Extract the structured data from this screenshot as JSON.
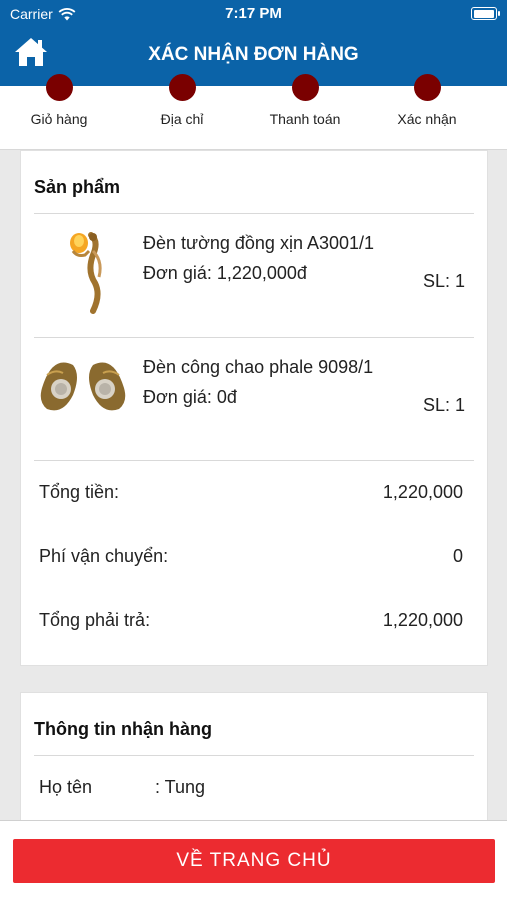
{
  "status_bar": {
    "carrier": "Carrier",
    "time": "7:17 PM",
    "battery_level": 0.9
  },
  "header": {
    "title": "XÁC NHẬN ĐƠN HÀNG",
    "home_icon": "home-icon"
  },
  "steps": [
    {
      "label": "Giỏ hàng"
    },
    {
      "label": "Địa chỉ"
    },
    {
      "label": "Thanh toán"
    },
    {
      "label": "Xác nhận"
    }
  ],
  "products_section": {
    "title": "Sản phẩm",
    "items": [
      {
        "name": "Đèn tường đồng xịn A3001/1",
        "price_label": "Đơn giá:",
        "price": "1,220,000đ",
        "qty_label": "SL:",
        "qty": "1"
      },
      {
        "name": "Đèn công chao phale 9098/1",
        "price_label": "Đơn giá:",
        "price": "0đ",
        "qty_label": "SL:",
        "qty": "1"
      }
    ],
    "summary": [
      {
        "label": "Tổng tiền:",
        "value": "1,220,000"
      },
      {
        "label": "Phí vận chuyển:",
        "value": "0"
      },
      {
        "label": "Tổng phải trả:",
        "value": "1,220,000"
      }
    ]
  },
  "info_section": {
    "title": "Thông tin nhận hàng",
    "rows": [
      {
        "label": "Họ tên",
        "value": ": Tung"
      }
    ]
  },
  "footer": {
    "button_label": "VỀ TRANG CHỦ"
  },
  "colors": {
    "primary": "#0b63a8",
    "step_dot": "#7a0000",
    "cta": "#ec2b30"
  }
}
